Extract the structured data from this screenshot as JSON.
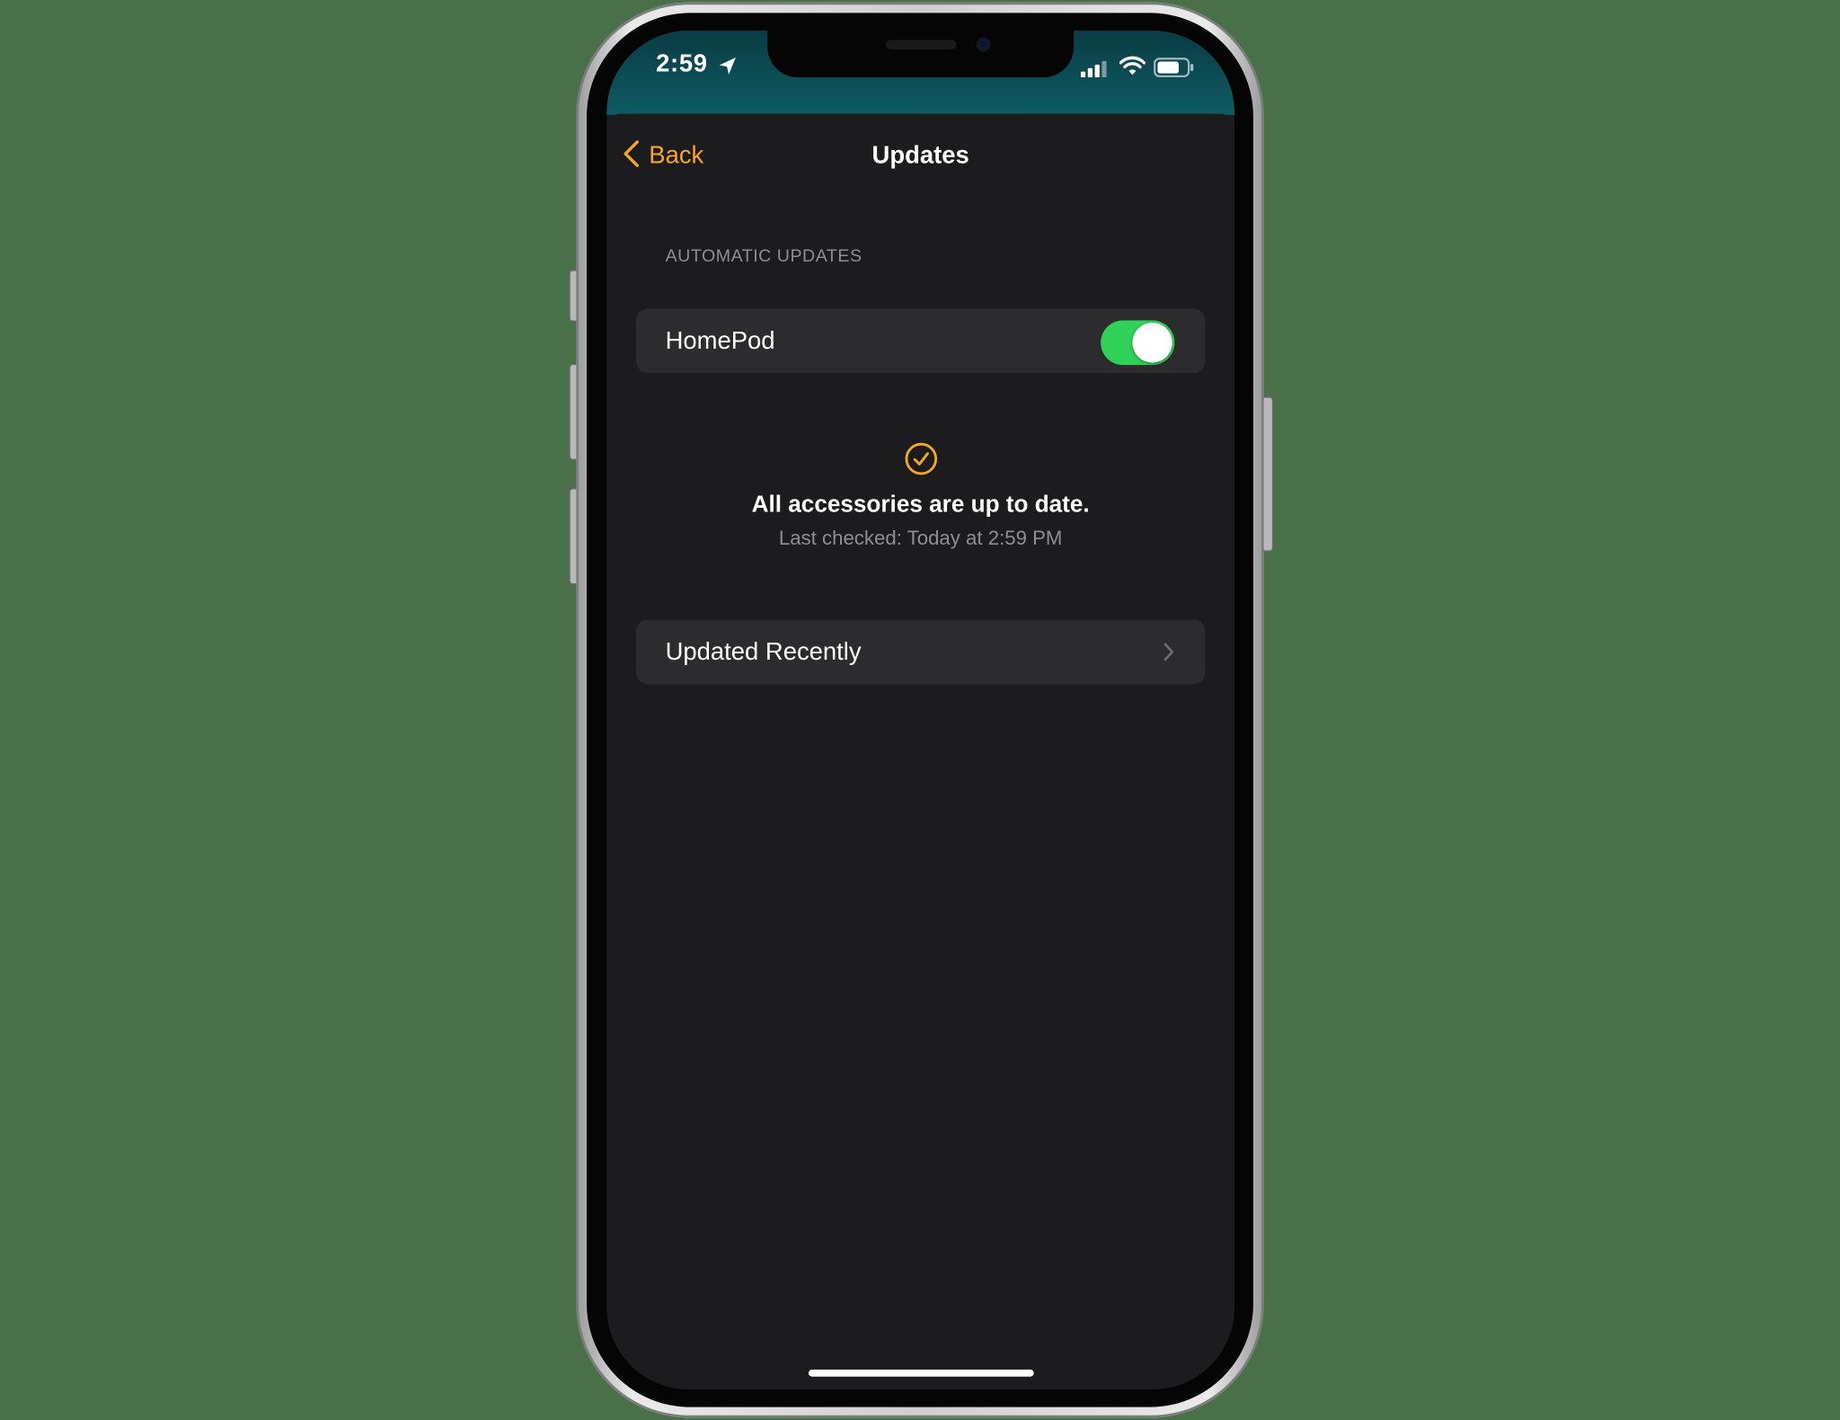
{
  "status_bar": {
    "time": "2:59"
  },
  "nav": {
    "back_label": "Back",
    "title": "Updates"
  },
  "automatic_updates": {
    "section_header": "AUTOMATIC UPDATES",
    "homepod_label": "HomePod",
    "homepod_enabled": true
  },
  "status": {
    "title": "All accessories are up to date.",
    "subtitle": "Last checked: Today at 2:59 PM"
  },
  "updated_recently": {
    "label": "Updated Recently"
  },
  "colors": {
    "accent": "#f5a623",
    "toggle_on": "#30d158",
    "background": "#1c1c1e",
    "cell": "#2c2c2e",
    "secondary_text": "#8e8e93",
    "status_bar": "#0f5b63",
    "page_background": "#4a7049"
  },
  "icons": {
    "location": "location-arrow-icon",
    "signal": "cellular-signal-icon",
    "wifi": "wifi-icon",
    "battery": "battery-icon",
    "back": "chevron-left-icon",
    "status": "checkmark-circle-icon",
    "disclosure": "chevron-right-icon"
  }
}
